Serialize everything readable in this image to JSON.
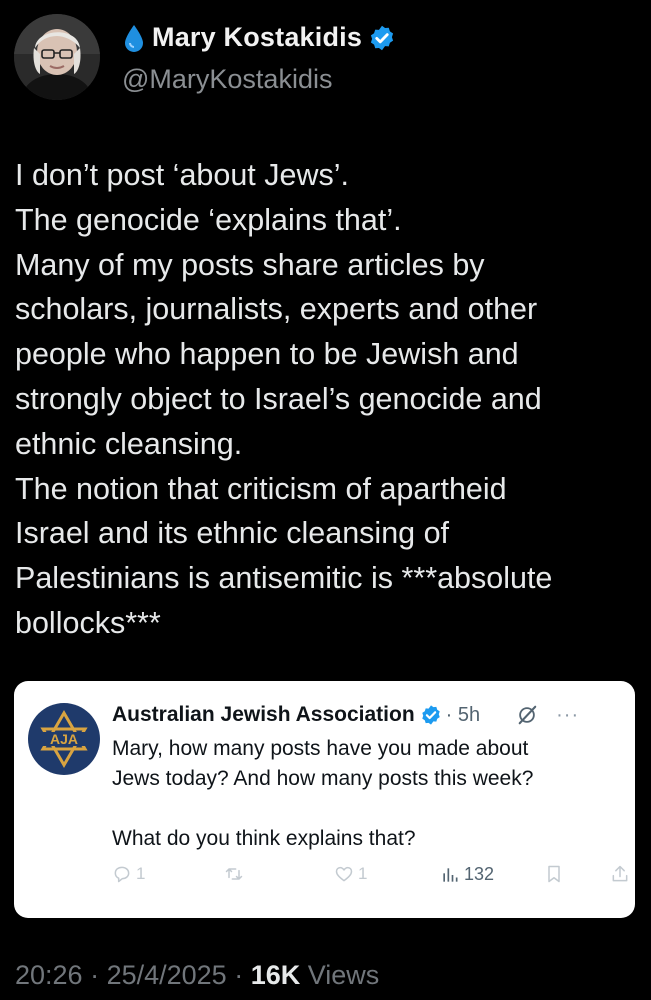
{
  "author": {
    "name": "Mary Kostakidis",
    "handle": "@MaryKostakidis",
    "avatar_icon": "user-photo",
    "name_emoji_icon": "droplet-icon",
    "verified_icon": "verified-badge-icon",
    "verified_color": "#1d9bf0"
  },
  "post": {
    "lines": [
      "I don’t post ‘about Jews’.",
      "The genocide ‘explains that’.",
      "Many of my posts share articles by",
      "scholars, journalists, experts and other",
      "people who happen to be Jewish and",
      "strongly object to Israel’s genocide and",
      "ethnic cleansing.",
      "The notion that criticism of apartheid",
      "Israel and its ethnic cleansing  of",
      "Palestinians is antisemitic is ***absolute",
      "bollocks***"
    ]
  },
  "quoted": {
    "name": "Australian Jewish Association",
    "time": "· 5h",
    "avatar_text": "AJA",
    "avatar_icon": "star-of-david-logo",
    "verified_icon": "verified-badge-icon",
    "grok_icon": "grok-icon",
    "more_label": "···",
    "text_lines": [
      "Mary, how many posts have you made about",
      "Jews today? And how many posts this week?"
    ],
    "text_lines_2": [
      "What do you think explains that?"
    ],
    "actions": {
      "replies": "1",
      "retweets": "",
      "likes": "1",
      "views": "132"
    }
  },
  "footer": {
    "time": "20:26",
    "sep1": " · ",
    "date": "25/4/2025",
    "sep2": " · ",
    "views_count": "16K",
    "views_label": " Views"
  },
  "colors": {
    "background": "#000000",
    "text": "#e7e9ea",
    "muted": "#71767b",
    "verified": "#1d9bf0",
    "card": "#ffffff",
    "aja_navy": "#1f3a6b",
    "aja_gold": "#d9a441"
  }
}
